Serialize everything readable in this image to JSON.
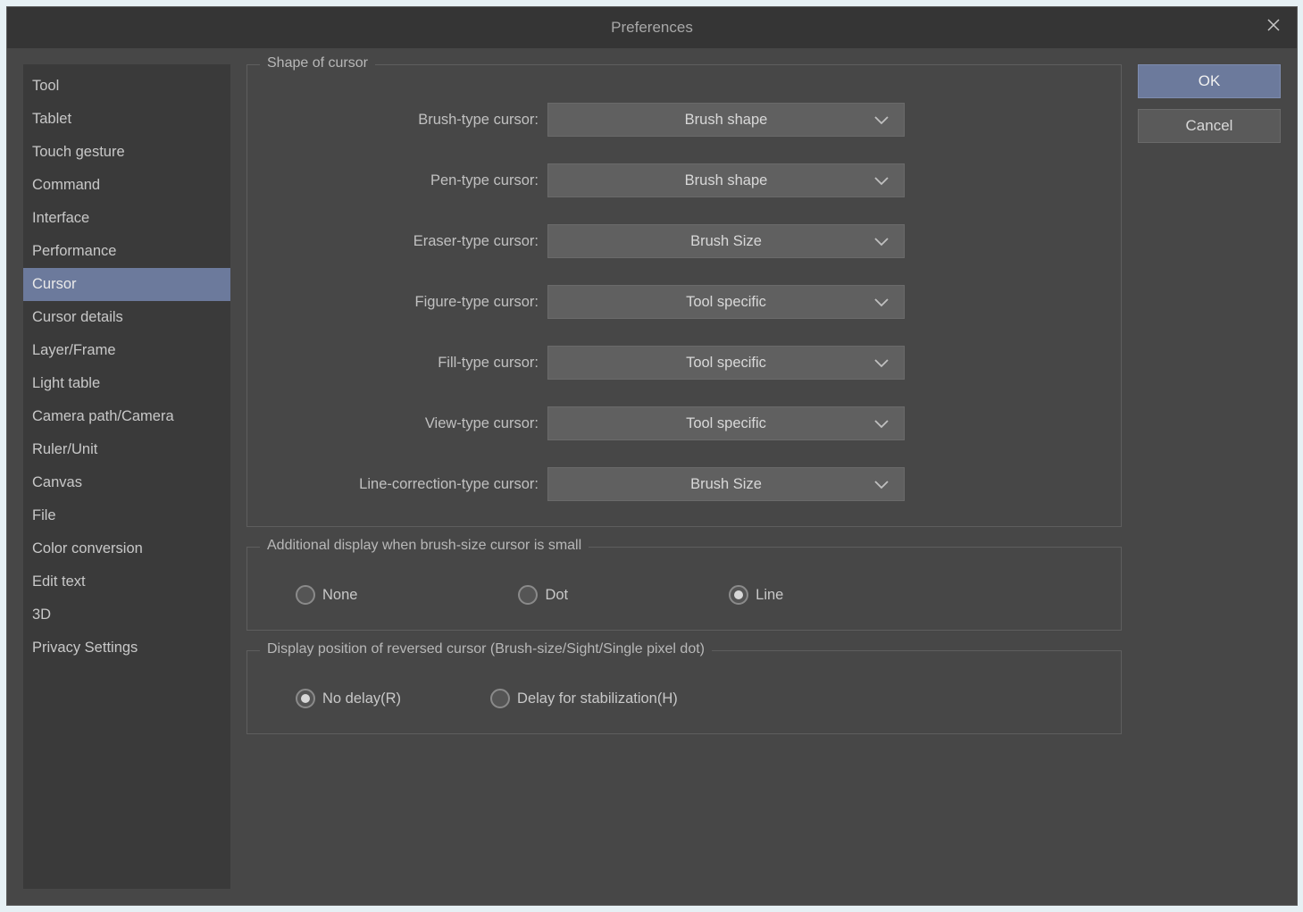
{
  "title": "Preferences",
  "sidebar": {
    "items": [
      "Tool",
      "Tablet",
      "Touch gesture",
      "Command",
      "Interface",
      "Performance",
      "Cursor",
      "Cursor details",
      "Layer/Frame",
      "Light table",
      "Camera path/Camera",
      "Ruler/Unit",
      "Canvas",
      "File",
      "Color conversion",
      "Edit text",
      "3D",
      "Privacy Settings"
    ],
    "selected_index": 6
  },
  "group_shape": {
    "title": "Shape of cursor",
    "rows": [
      {
        "label": "Brush-type cursor:",
        "value": "Brush shape"
      },
      {
        "label": "Pen-type cursor:",
        "value": "Brush shape"
      },
      {
        "label": "Eraser-type cursor:",
        "value": "Brush Size"
      },
      {
        "label": "Figure-type cursor:",
        "value": "Tool specific"
      },
      {
        "label": "Fill-type cursor:",
        "value": "Tool specific"
      },
      {
        "label": "View-type cursor:",
        "value": "Tool specific"
      },
      {
        "label": "Line-correction-type cursor:",
        "value": "Brush Size"
      }
    ]
  },
  "group_additional": {
    "title": "Additional display when brush-size cursor is small",
    "options": [
      "None",
      "Dot",
      "Line"
    ],
    "selected_index": 2
  },
  "group_reversed": {
    "title": "Display position of reversed cursor (Brush-size/Sight/Single pixel dot)",
    "options": [
      "No delay(R)",
      "Delay for stabilization(H)"
    ],
    "selected_index": 0
  },
  "buttons": {
    "ok": "OK",
    "cancel": "Cancel"
  }
}
